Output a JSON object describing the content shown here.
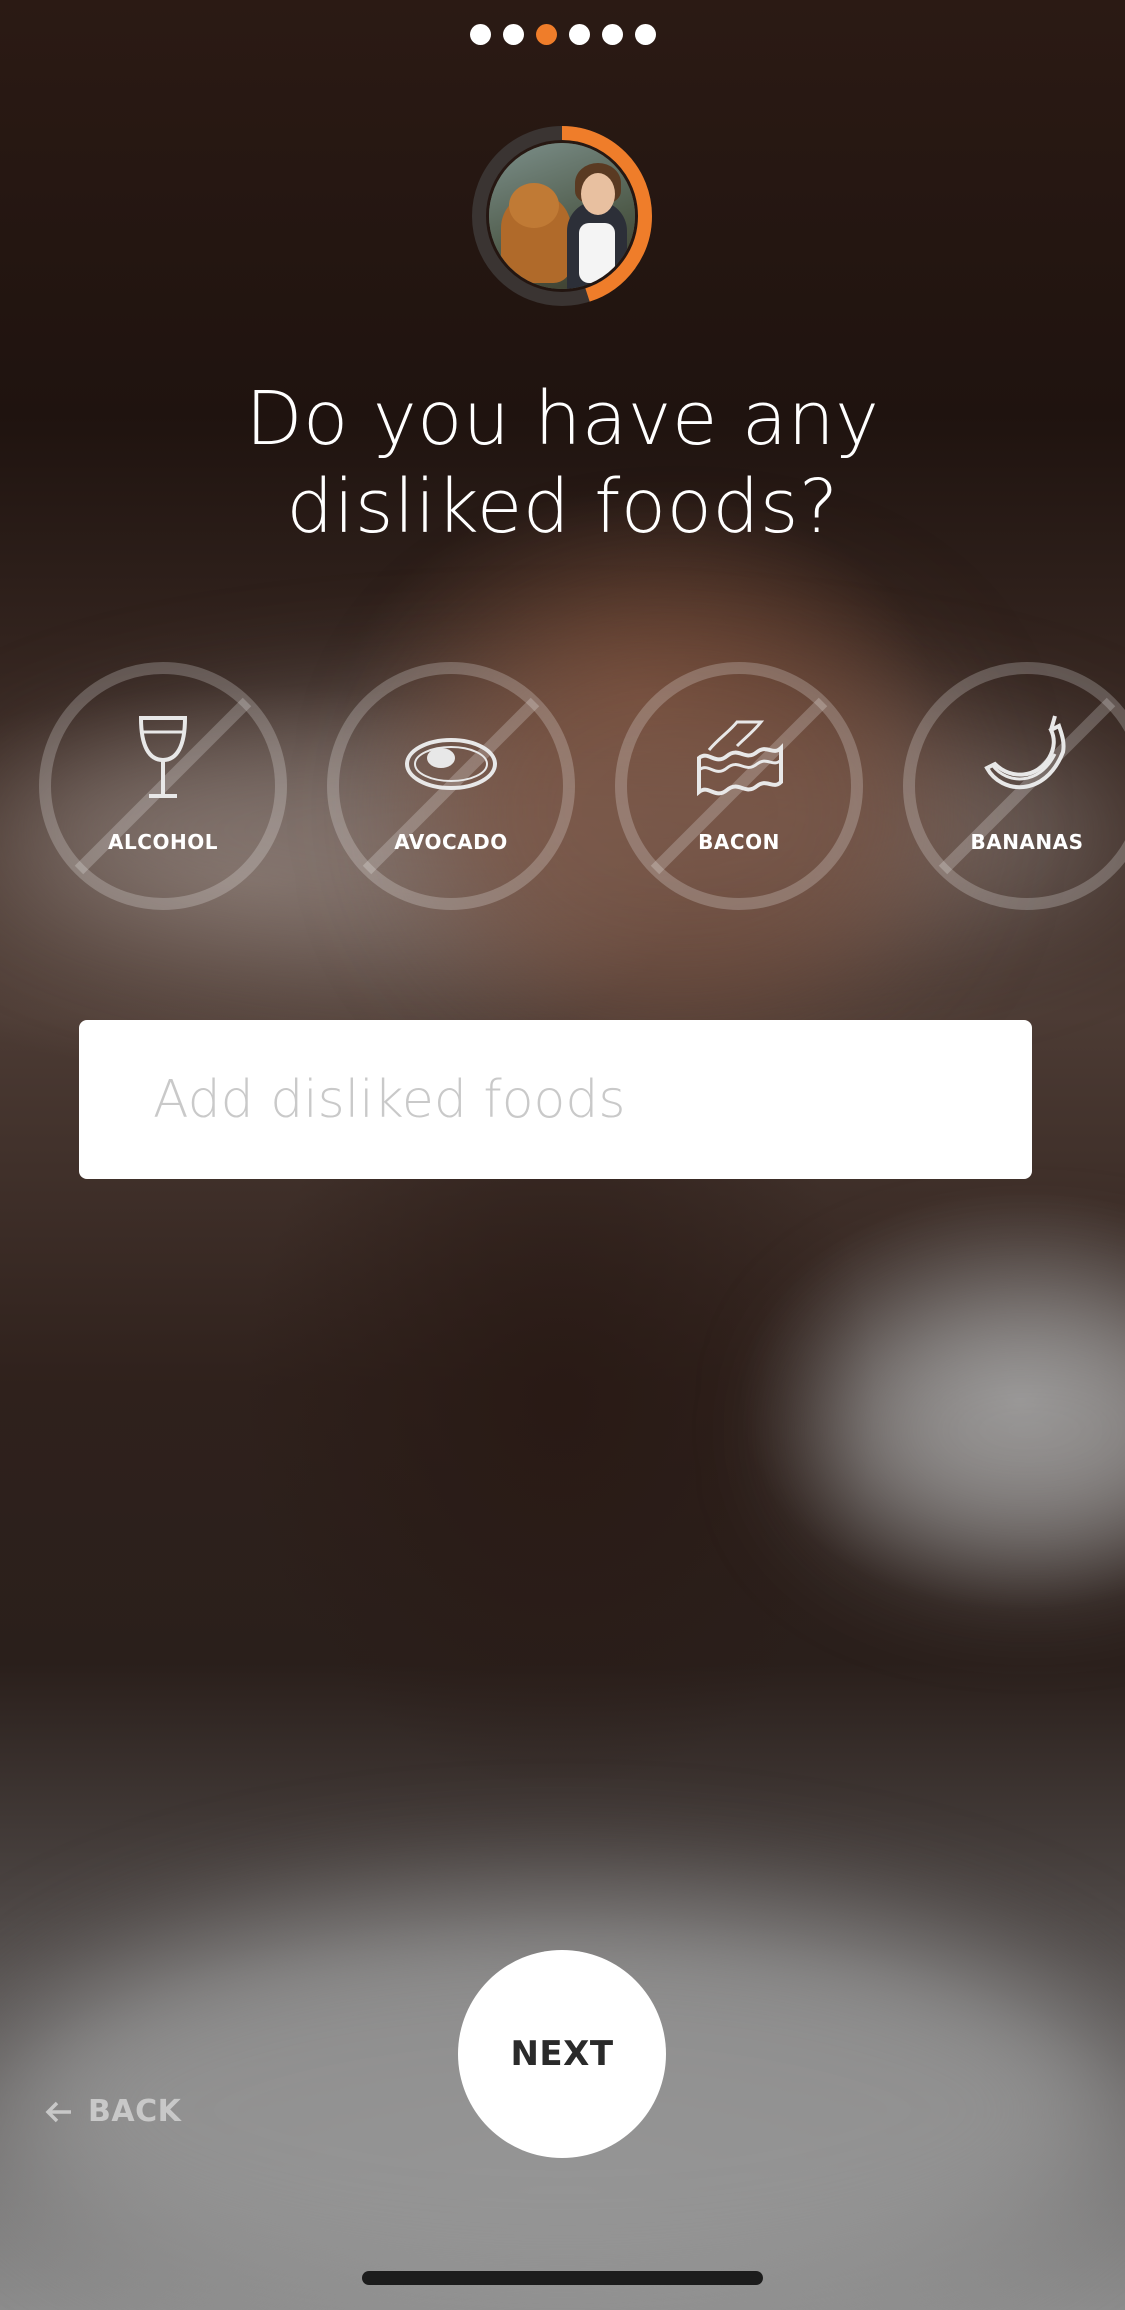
{
  "progress": {
    "total_steps": 6,
    "current_step": 3,
    "active_color": "#ef7d2a",
    "inactive_color": "#ffffff"
  },
  "avatar": {
    "ring_progress": 0.45,
    "ring_color": "#ef7d2a"
  },
  "question": {
    "line1": "Do you have any",
    "line2": "disliked foods?"
  },
  "foods": [
    {
      "label": "ALCOHOL",
      "icon": "wine-glass-icon"
    },
    {
      "label": "AVOCADO",
      "icon": "avocado-icon"
    },
    {
      "label": "BACON",
      "icon": "bacon-icon"
    },
    {
      "label": "BANANAS",
      "icon": "banana-icon"
    }
  ],
  "search": {
    "placeholder": "Add disliked foods",
    "value": ""
  },
  "actions": {
    "next_label": "NEXT",
    "back_label": "BACK"
  }
}
